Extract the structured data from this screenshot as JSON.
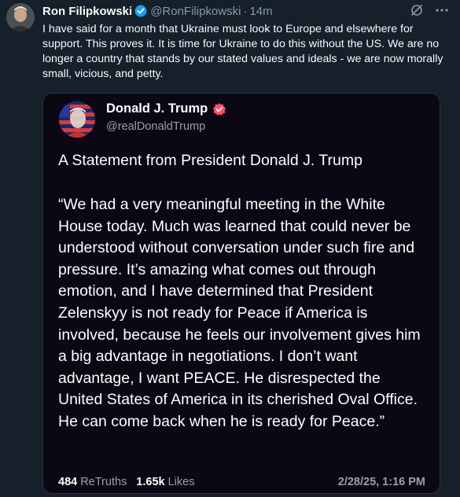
{
  "tweet": {
    "author_name": "Ron Filipkowski",
    "handle": "@RonFilipkowski",
    "separator": "·",
    "time": "14m",
    "text": "I have said for a month that Ukraine must look to Europe and elsewhere for support. This proves it. It is time for Ukraine to do this without the US. We are no longer a country that stands by our stated values and ideals - we are now morally small, vicious, and petty.",
    "icons": [
      "verified-icon",
      "grok-icon",
      "more-icon"
    ]
  },
  "quote": {
    "author_name": "Donald J. Trump",
    "handle": "@realDonaldTrump",
    "title": "A Statement from President Donald J. Trump",
    "body": "“We had a very meaningful meeting in the White House today. Much was learned that could never be understood without conversation under such fire and pressure. It’s amazing what comes out through emotion, and I have determined that President Zelenskyy is not ready for Peace if America is involved, because he feels our involvement gives him a big advantage in negotiations. I don’t want advantage, I want PEACE. He disrespected the United States of America in its cherished Oval Office. He can come back when he is ready for Peace.”",
    "retruths_count": "484",
    "retruths_label": "ReTruths",
    "likes_count": "1.65k",
    "likes_label": "Likes",
    "date": "2/28/25, 1:16 PM"
  },
  "colors": {
    "background": "#15202b",
    "quote_background": "#0b0713",
    "verified_blue": "#1d9bf0",
    "truth_badge": "#ff4f6e"
  }
}
